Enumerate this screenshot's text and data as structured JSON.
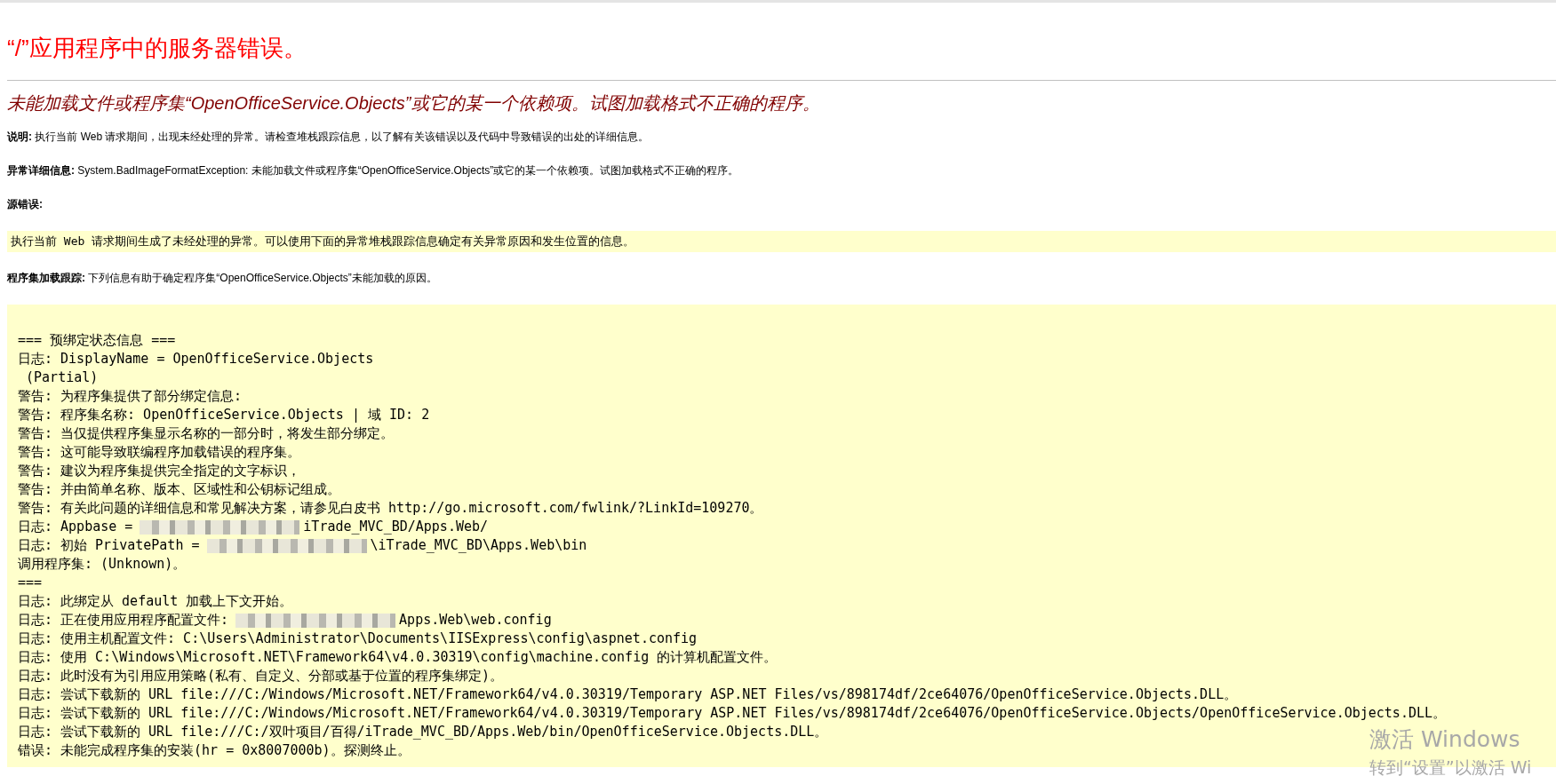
{
  "title": "“/”应用程序中的服务器错误。",
  "error_heading": "未能加载文件或程序集“OpenOfficeService.Objects”或它的某一个依赖项。试图加载格式不正确的程序。",
  "description": "**说明:** 执行当前 Web 请求期间，出现未经处理的异常。请检查堆栈跟踪信息，以了解有关该错误以及代码中导致错误的出处的详细信息。",
  "exception_details": "**异常详细信息:** System.BadImageFormatException: 未能加载文件或程序集“OpenOfficeService.Objects”或它的某一个依赖项。试图加载格式不正确的程序。",
  "source_error": {
    "label": "源错误:",
    "message": "执行当前 Web 请求期间生成了未经处理的异常。可以使用下面的异常堆栈跟踪信息确定有关异常原因和发生位置的信息。"
  },
  "assembly_load_trace": {
    "summary": "**程序集加载跟踪:** 下列信息有助于确定程序集“OpenOfficeService.Objects”未能加载的原因。",
    "lines": [
      {
        "kind": "plain",
        "text": "=== 预绑定状态信息 ==="
      },
      {
        "kind": "plain",
        "text": "日志: DisplayName = OpenOfficeService.Objects"
      },
      {
        "kind": "plain",
        "text": " (Partial)"
      },
      {
        "kind": "plain",
        "text": "警告: 为程序集提供了部分绑定信息:"
      },
      {
        "kind": "plain",
        "text": "警告: 程序集名称: OpenOfficeService.Objects | 域 ID: 2"
      },
      {
        "kind": "plain",
        "text": "警告: 当仅提供程序集显示名称的一部分时，将发生部分绑定。"
      },
      {
        "kind": "plain",
        "text": "警告: 这可能导致联编程序加载错误的程序集。"
      },
      {
        "kind": "plain",
        "text": "警告: 建议为程序集提供完全指定的文字标识，"
      },
      {
        "kind": "plain",
        "text": "警告: 并由简单名称、版本、区域性和公钥标记组成。"
      },
      {
        "kind": "plain",
        "text": "警告: 有关此问题的详细信息和常见解决方案，请参见白皮书 http://go.microsoft.com/fwlink/?LinkId=109270。"
      },
      {
        "kind": "redacted",
        "before": "日志: Appbase =",
        "after": "iTrade_MVC_BD/Apps.Web/"
      },
      {
        "kind": "redacted",
        "before": "日志: 初始 PrivatePath =",
        "after": "\\iTrade_MVC_BD\\Apps.Web\\bin"
      },
      {
        "kind": "plain",
        "text": "调用程序集: (Unknown)。"
      },
      {
        "kind": "plain",
        "text": "==="
      },
      {
        "kind": "plain",
        "text": "日志: 此绑定从 default 加载上下文开始。"
      },
      {
        "kind": "redacted",
        "before": "日志: 正在使用应用程序配置文件:",
        "after": "Apps.Web\\web.config"
      },
      {
        "kind": "plain",
        "text": "日志: 使用主机配置文件: C:\\Users\\Administrator\\Documents\\IISExpress\\config\\aspnet.config"
      },
      {
        "kind": "plain",
        "text": "日志: 使用 C:\\Windows\\Microsoft.NET\\Framework64\\v4.0.30319\\config\\machine.config 的计算机配置文件。"
      },
      {
        "kind": "plain",
        "text": "日志: 此时没有为引用应用策略(私有、自定义、分部或基于位置的程序集绑定)。"
      },
      {
        "kind": "plain",
        "text": "日志: 尝试下载新的 URL file:///C:/Windows/Microsoft.NET/Framework64/v4.0.30319/Temporary ASP.NET Files/vs/898174df/2ce64076/OpenOfficeService.Objects.DLL。"
      },
      {
        "kind": "plain",
        "text": "日志: 尝试下载新的 URL file:///C:/Windows/Microsoft.NET/Framework64/v4.0.30319/Temporary ASP.NET Files/vs/898174df/2ce64076/OpenOfficeService.Objects/OpenOfficeService.Objects.DLL。"
      },
      {
        "kind": "plain",
        "text": "日志: 尝试下载新的 URL file:///C:/双叶项目/百得/iTrade_MVC_BD/Apps.Web/bin/OpenOfficeService.Objects.DLL。"
      },
      {
        "kind": "plain",
        "text": "错误: 未能完成程序集的安装(hr = 0x8007000b)。探测终止。"
      }
    ]
  },
  "windows_activation": {
    "title": "激活 Windows",
    "hint": "转到“设置”以激活 Wi"
  }
}
